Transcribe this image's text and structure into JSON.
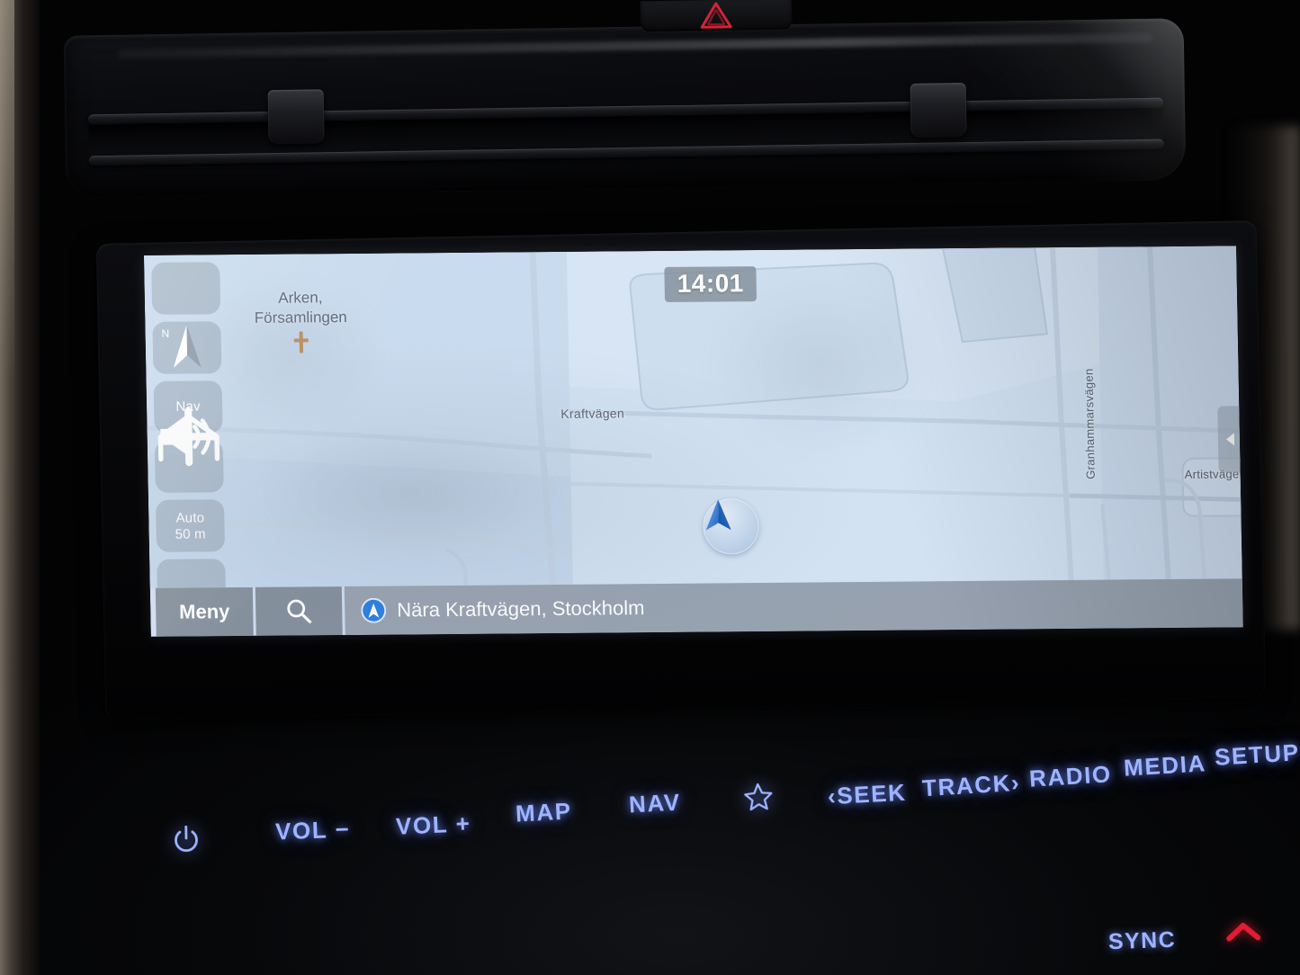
{
  "device": {
    "name": "car-infotainment-head-unit",
    "screen_mode": "navigation-map"
  },
  "map_screen": {
    "clock": "14:01",
    "poi": {
      "label_line1": "Arken,",
      "label_line2": "Församlingen",
      "icon": "church-cross-icon"
    },
    "street_labels": [
      {
        "name": "Kraftvägen",
        "orientation": "horizontal"
      },
      {
        "name": "Granhammarsvägen",
        "orientation": "vertical"
      },
      {
        "name": "Artistvägen",
        "orientation": "horizontal"
      }
    ],
    "vehicle_marker_icon": "navigation-arrow-icon",
    "side_tab_icon": "chevron-left-icon"
  },
  "map_rail": {
    "items": [
      {
        "id": "home",
        "icon": "home-icon",
        "label": ""
      },
      {
        "id": "compass",
        "icon": "compass-needle-icon",
        "label": "N"
      },
      {
        "id": "nav-volume",
        "icon": "speaker-icon",
        "label": "Nav"
      },
      {
        "id": "zoom-in",
        "icon": "plus-icon",
        "label": ""
      },
      {
        "id": "scale",
        "icon": "",
        "label_line1": "Auto",
        "label_line2": "50 m"
      },
      {
        "id": "zoom-out",
        "icon": "minus-icon",
        "label": ""
      }
    ]
  },
  "status_bar": {
    "menu_label": "Meny",
    "search_icon": "search-icon",
    "location_icon": "location-arrow-badge-icon",
    "location_text": "Nära Kraftvägen, Stockholm"
  },
  "hardware_buttons": [
    {
      "id": "power",
      "label": "",
      "icon": "power-icon"
    },
    {
      "id": "vol-down",
      "label": "VOL −",
      "icon": ""
    },
    {
      "id": "vol-up",
      "label": "VOL +",
      "icon": ""
    },
    {
      "id": "map",
      "label": "MAP",
      "icon": ""
    },
    {
      "id": "nav",
      "label": "NAV",
      "icon": ""
    },
    {
      "id": "favorite",
      "label": "",
      "icon": "star-icon"
    },
    {
      "id": "seek",
      "label": "‹SEEK",
      "icon": ""
    },
    {
      "id": "track",
      "label": "TRACK›",
      "icon": ""
    },
    {
      "id": "radio",
      "label": "RADIO",
      "icon": ""
    },
    {
      "id": "media",
      "label": "MEDIA",
      "icon": ""
    },
    {
      "id": "setup",
      "label": "SETUP",
      "icon": ""
    }
  ],
  "console": {
    "sync_label": "SYNC",
    "hazard_icon": "hazard-triangle-icon",
    "up_caret_icon": "chevron-up-icon"
  },
  "colors": {
    "map_background": "#cfe0f2",
    "map_shade": "#bccfe6",
    "rail_button": "#96a3b1",
    "status_bar": "#8f99a5",
    "accent_blue": "#2b7fe0",
    "button_glow": "#9fb4ff",
    "hazard_red": "#d1243a",
    "poi_cross": "#c08a52"
  }
}
